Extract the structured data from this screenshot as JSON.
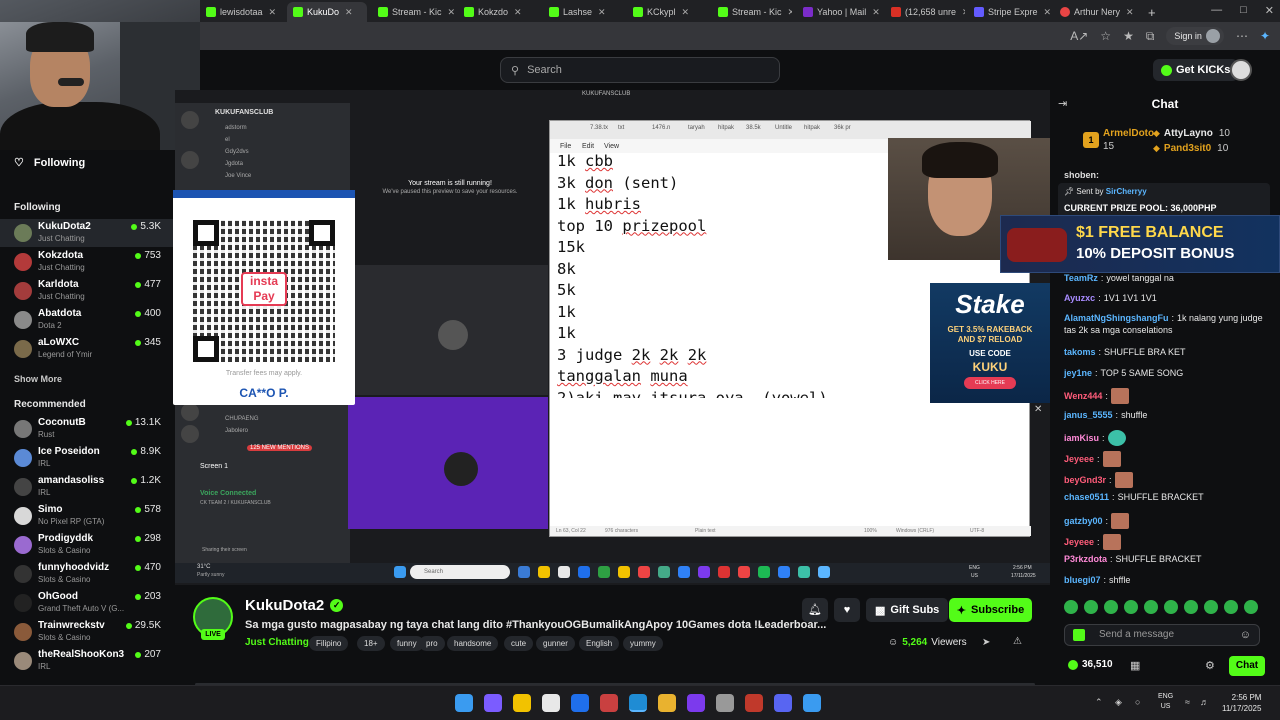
{
  "browser": {
    "tabs": [
      {
        "label": "lewisdotaa",
        "icon": "kick"
      },
      {
        "label": "KukuDo",
        "icon": "kick",
        "active": true
      },
      {
        "label": "Stream - Kic",
        "icon": "kick"
      },
      {
        "label": "Kokzdo",
        "icon": "kick"
      },
      {
        "label": "Lashse",
        "icon": "kick"
      },
      {
        "label": "KCkypl",
        "icon": "kick"
      },
      {
        "label": "Stream - Kic",
        "icon": "kick"
      },
      {
        "label": "Yahoo | Mail",
        "icon": "yahoo"
      },
      {
        "label": "(12,658 unre",
        "icon": "gmail"
      },
      {
        "label": "Stripe Expre",
        "icon": "stripe"
      },
      {
        "label": "Arthur Nery",
        "icon": "outlook"
      }
    ],
    "new_tab": "+",
    "signin_label": "Sign in"
  },
  "header": {
    "search_placeholder": "Search",
    "get_kicks_label": "Get KICKs"
  },
  "sidebar": {
    "following_title": "Following",
    "following_section": "Following",
    "following": [
      {
        "name": "KukuDota2",
        "category": "Just Chatting",
        "viewers": "5.3K",
        "color": "#6b7b58"
      },
      {
        "name": "Kokzdota",
        "category": "Just Chatting",
        "viewers": "753",
        "color": "#b33a3a"
      },
      {
        "name": "Karldota",
        "category": "Just Chatting",
        "viewers": "477",
        "color": "#a33c3c"
      },
      {
        "name": "Abatdota",
        "category": "Dota 2",
        "viewers": "400",
        "color": "#8a8a8a"
      },
      {
        "name": "aLoWXC",
        "category": "Legend of Ymir",
        "viewers": "345",
        "color": "#7a6a4a"
      }
    ],
    "show_more": "Show More",
    "recommended_section": "Recommended",
    "recommended": [
      {
        "name": "CoconutB",
        "category": "Rust",
        "viewers": "13.1K",
        "color": "#777"
      },
      {
        "name": "Ice Poseidon",
        "category": "IRL",
        "viewers": "8.9K",
        "color": "#5b8ad6"
      },
      {
        "name": "amandasoliss",
        "category": "IRL",
        "viewers": "1.2K",
        "color": "#444"
      },
      {
        "name": "Simo",
        "category": "No Pixel RP (GTA)",
        "viewers": "578",
        "color": "#d8d8d8"
      },
      {
        "name": "Prodigyddk",
        "category": "Slots & Casino",
        "viewers": "298",
        "color": "#9a6ad0"
      },
      {
        "name": "funnyhoodvidz",
        "category": "Slots & Casino",
        "viewers": "470",
        "color": "#333"
      },
      {
        "name": "OhGood",
        "category": "Grand Theft Auto V (G...",
        "viewers": "203",
        "color": "#222"
      },
      {
        "name": "Trainwreckstv",
        "category": "Slots & Casino",
        "viewers": "29.5K",
        "color": "#8a5a3a"
      },
      {
        "name": "theRealShooKon3",
        "category": "IRL",
        "viewers": "207",
        "color": "#9a8a7a"
      }
    ]
  },
  "stream_content": {
    "discord_server": "KUKUFANSCLUB",
    "discord_channels": [
      "adstorm",
      "el",
      "Gdy2dvs",
      "Jgdota",
      "Joe Vince"
    ],
    "discord_lower": [
      "CHUPAENG",
      "Jabolero"
    ],
    "new_mentions": "125 NEW MENTIONS",
    "screen_label": "Screen 1",
    "voice_connected": "Voice Connected",
    "voice_sub": "CK TEAM 2 / KUKUFANSCLUB",
    "sharing": "Sharing their screen",
    "stream_running": "Your stream is still running!",
    "stream_running_sub": "We've paused this preview to save your resources.",
    "top_strip_label": "KUKUFANSCLUB",
    "qr_brand": "insta Pay",
    "qr_fees": "Transfer fees may apply.",
    "qr_name": "CA**O P.",
    "notepad_tabs": [
      "7.38.tx",
      "txt",
      "1476.n",
      "taryah",
      "hitpak",
      "38.5k",
      "Untitle",
      "hitpak",
      "36k pr"
    ],
    "notepad_menu": [
      "File",
      "Edit",
      "View"
    ],
    "notepad_lines": [
      "1k cbb",
      "3k don (sent)",
      "1k hubris",
      "",
      "top 10 prizepool",
      "15k",
      "8k",
      "5k",
      "1k",
      "1k",
      "",
      "3 judge 2k 2k 2k",
      "",
      "",
      "",
      "tanggalan muna",
      "",
      "2)aki may itsura oya  (yowel)"
    ],
    "notepad_status": [
      "Ln 63, Col 22",
      "976 characters",
      "Plain text",
      "100%",
      "Windows (CRLF)",
      "UTF-8"
    ],
    "stake_brand": "Stake",
    "stake_line1": "GET 3.5% RAKEBACK",
    "stake_line2": "AND $7 RELOAD",
    "stake_use_code": "USE CODE",
    "stake_code": "KUKU",
    "stake_cta": "CLICK HERE",
    "inner_search": "Search",
    "inner_weather": "31°C",
    "inner_weather_sub": "Partly sunny",
    "inner_clock": "2:56 PM",
    "inner_date": "17/11/2025",
    "inner_lang": "ENG",
    "inner_region": "US"
  },
  "info": {
    "live": "LIVE",
    "streamer": "KukuDota2",
    "title": "Sa mga gusto magpasabay ng taya chat lang dito #ThankyouOGBumalikAngApoy 10Games dota  !Leaderboar...",
    "category": "Just Chatting",
    "tags": [
      "Filipino",
      "18+",
      "funny",
      "pro",
      "handsome",
      "cute",
      "gunner",
      "English",
      "yummy"
    ],
    "gift_subs": "Gift Subs",
    "subscribe": "Subscribe",
    "viewers": "5,264",
    "viewers_label": "Viewers"
  },
  "chat": {
    "title": "Chat",
    "gifters": [
      {
        "name": "ArmelDoto",
        "count": "15",
        "rank": "1"
      },
      {
        "name": "AttyLayno",
        "count": "10"
      },
      {
        "name": "Pand3sit0",
        "count": "10"
      }
    ],
    "shoben": "shoben:",
    "pinned_sent_by": "Sent by",
    "pinned_author": "SirCherryy",
    "pinned_text": "CURRENT PRIZE POOL: 36,000PHP",
    "promo_line1": "$1 FREE BALANCE",
    "promo_line2": "10% DEPOSIT BONUS",
    "messages": [
      {
        "user": "TeamRz",
        "text": "yowel tanggal na",
        "color": "#5bb6ff"
      },
      {
        "user": "Ayuzxc",
        "text": "1V1 1V1 1V1",
        "color": "#a88bff"
      },
      {
        "user": "AlamatNgShingshangFu",
        "text": "1k nalang yung judge",
        "color": "#5bb6ff"
      },
      {
        "user": "",
        "text": "tas 2k sa mga conselations",
        "color": "#e8e8e8"
      },
      {
        "user": "takoms",
        "text": "SHUFFLE BRA KET",
        "color": "#5bb6ff"
      },
      {
        "user": "jey1ne",
        "text": "TOP 5 SAME SONG",
        "color": "#5bb6ff"
      },
      {
        "user": "Wenz444",
        "text": "",
        "color": "#ff5c7a",
        "emote": true
      },
      {
        "user": "janus_5555",
        "text": "shuffle",
        "color": "#5bb6ff"
      },
      {
        "user": "iamKisu",
        "text": "",
        "color": "#ff8ad8",
        "emote_g": true
      },
      {
        "user": "Jeyeee",
        "text": "",
        "color": "#ff5c7a",
        "emote": true
      },
      {
        "user": "beyGnd3r",
        "text": "",
        "color": "#ff5c7a",
        "emote": true
      },
      {
        "user": "chase0511",
        "text": "SHUFFLE BRACKET",
        "color": "#5bb6ff"
      },
      {
        "user": "gatzby00",
        "text": "",
        "color": "#5bb6ff",
        "emote": true
      },
      {
        "user": "Jeyeee",
        "text": "",
        "color": "#ff5c7a",
        "emote": true
      },
      {
        "user": "P3rkzdota",
        "text": "SHUFFLE BRACKET",
        "color": "#ff8ad8"
      },
      {
        "user": "bluegi07",
        "text": "shffle",
        "color": "#5bb6ff"
      }
    ],
    "input_placeholder": "Send a message",
    "kicks_points": "36,510",
    "chat_button": "Chat"
  },
  "taskbar": {
    "lang": "ENG",
    "region": "US",
    "time": "2:56 PM",
    "date": "11/17/2025"
  }
}
